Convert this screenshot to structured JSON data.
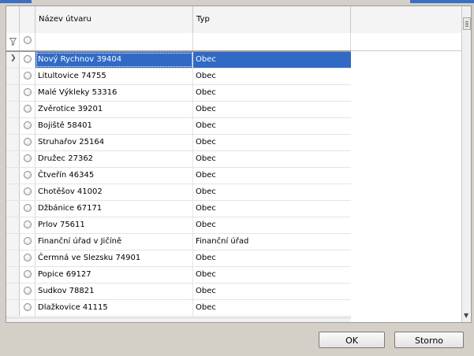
{
  "grid": {
    "columns": {
      "name_header": "Název útvaru",
      "type_header": "Typ"
    },
    "rows": [
      {
        "name": "Nový Rychnov 39404",
        "type": "Obec",
        "selected": true
      },
      {
        "name": "Litultovice 74755",
        "type": "Obec"
      },
      {
        "name": "Malé Výkleky 53316",
        "type": "Obec"
      },
      {
        "name": "Zvěrotice 39201",
        "type": "Obec"
      },
      {
        "name": "Bojiště 58401",
        "type": "Obec"
      },
      {
        "name": "Struhařov 25164",
        "type": "Obec"
      },
      {
        "name": "Družec 27362",
        "type": "Obec"
      },
      {
        "name": "Čtveřín 46345",
        "type": "Obec"
      },
      {
        "name": "Chotěšov 41002",
        "type": "Obec"
      },
      {
        "name": "Džbánice 67171",
        "type": "Obec"
      },
      {
        "name": "Prlov 75611",
        "type": "Obec"
      },
      {
        "name": "Finanční úřad v Jičíně",
        "type": "Finanční úřad"
      },
      {
        "name": "Čermná ve Slezsku 74901",
        "type": "Obec"
      },
      {
        "name": "Popice 69127",
        "type": "Obec"
      },
      {
        "name": "Sudkov 78821",
        "type": "Obec"
      },
      {
        "name": "Dlažkovice 41115",
        "type": "Obec"
      }
    ]
  },
  "icons": {
    "filter": "filter-icon",
    "row_indicator": "row-pointer-icon",
    "scroll_down": "scroll-down-arrow-icon"
  },
  "buttons": {
    "ok": "OK",
    "cancel": "Storno"
  },
  "colors": {
    "selection": "#316ac5",
    "dialog_bg": "#d4d0c8"
  }
}
